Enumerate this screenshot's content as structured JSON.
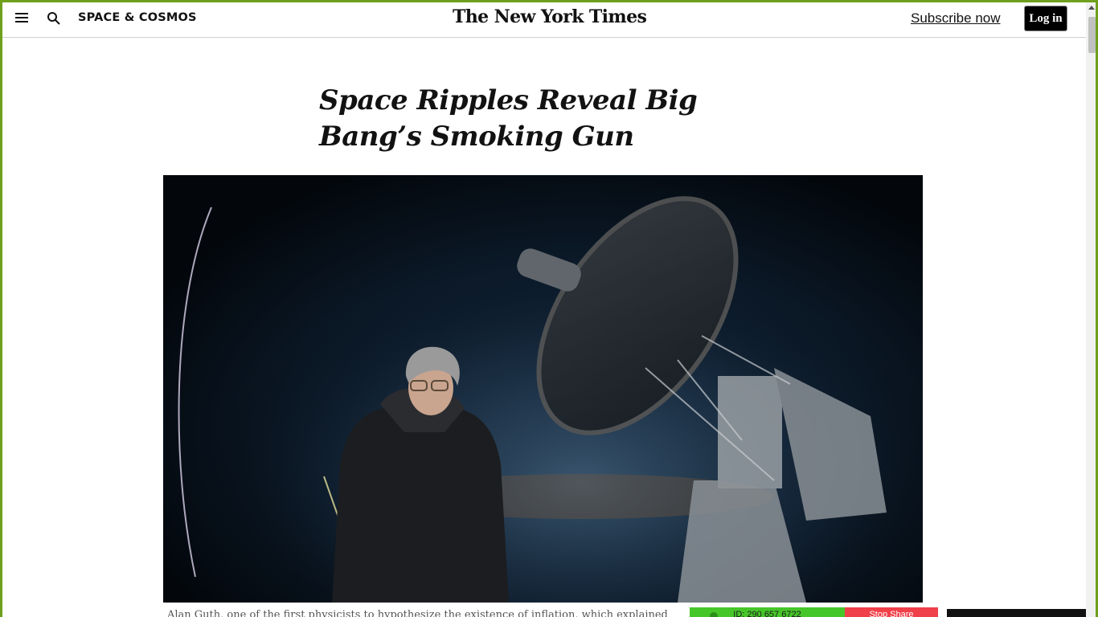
{
  "topbar": {
    "menu_icon": "hamburger-menu-icon",
    "search_icon": "search-icon",
    "section": "SPACE & COSMOS",
    "masthead": "The New York Times",
    "subscribe_label": "Subscribe now",
    "login_label": "Log in"
  },
  "article": {
    "headline": "Space Ripples Reveal Big Bang’s Smoking Gun",
    "caption_partial": "Alan Guth, one of the first physicists to hypothesize the existence of inflation, which explained"
  },
  "share_bar": {
    "id_label": "ID: 290 657 6722",
    "stop_label": "Stop Share"
  },
  "colors": {
    "frame_border": "#6ea01e",
    "share_green": "#47c62a",
    "share_red": "#f0404a",
    "login_bg": "#000000"
  }
}
